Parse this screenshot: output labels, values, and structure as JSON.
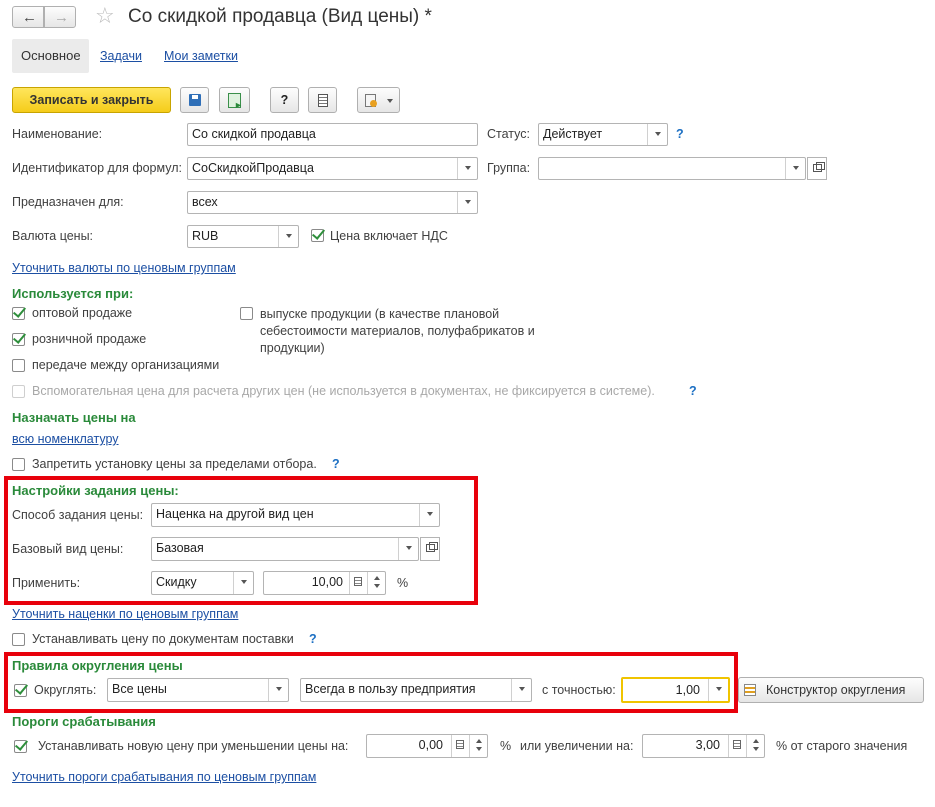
{
  "title": "Со скидкой продавца (Вид цены) *",
  "tabs": {
    "main": "Основное",
    "tasks": "Задачи",
    "notes": "Мои заметки"
  },
  "toolbar": {
    "save_close": "Записать и закрыть",
    "help": "?"
  },
  "form": {
    "name_label": "Наименование:",
    "name_value": "Со скидкой продавца",
    "status_label": "Статус:",
    "status_value": "Действует",
    "formula_id_label": "Идентификатор для формул:",
    "formula_id_value": "СоСкидкойПродавца",
    "group_label": "Группа:",
    "group_value": "",
    "purpose_label": "Предназначен для:",
    "purpose_value": "всех",
    "currency_label": "Валюта цены:",
    "currency_value": "RUB",
    "vat_label": "Цена включает НДС",
    "currency_link": "Уточнить валюты по ценовым группам"
  },
  "usage": {
    "heading": "Используется при:",
    "wholesale": "оптовой продаже",
    "retail": "розничной продаже",
    "transfer": "передаче между организациями",
    "production": "выпуске продукции (в качестве плановой себестоимости материалов, полуфабрикатов и продукции)",
    "auxiliary": "Вспомогательная цена для расчета других цен (не используется в документах, не фиксируется в системе)."
  },
  "assign": {
    "heading": "Назначать цены на",
    "link": "всю номенклатуру",
    "forbid": "Запретить установку цены за пределами отбора."
  },
  "price_settings": {
    "heading": "Настройки задания цены:",
    "method_label": "Способ задания цены:",
    "method_value": "Наценка на другой вид цен",
    "base_label": "Базовый вид цены:",
    "base_value": "Базовая",
    "apply_label": "Применить:",
    "apply_value": "Скидку",
    "percent_value": "10,00",
    "percent_sign": "%",
    "markup_link": "Уточнить наценки по ценовым группам",
    "by_supply": "Устанавливать цену по документам поставки"
  },
  "rounding": {
    "heading": "Правила округления цены",
    "round_label": "Округлять:",
    "scope_value": "Все цены",
    "direction_value": "Всегда в пользу предприятия",
    "precision_label": "с точностью:",
    "precision_value": "1,00",
    "constructor_button": "Конструктор округления"
  },
  "thresholds": {
    "heading": "Пороги срабатывания",
    "label": "Устанавливать новую цену при уменьшении цены на:",
    "decrease_value": "0,00",
    "pct1": "%",
    "increase_label": "или увеличении на:",
    "increase_value": "3,00",
    "pct2": "% от старого значения",
    "link": "Уточнить пороги срабатывания по ценовым группам"
  }
}
